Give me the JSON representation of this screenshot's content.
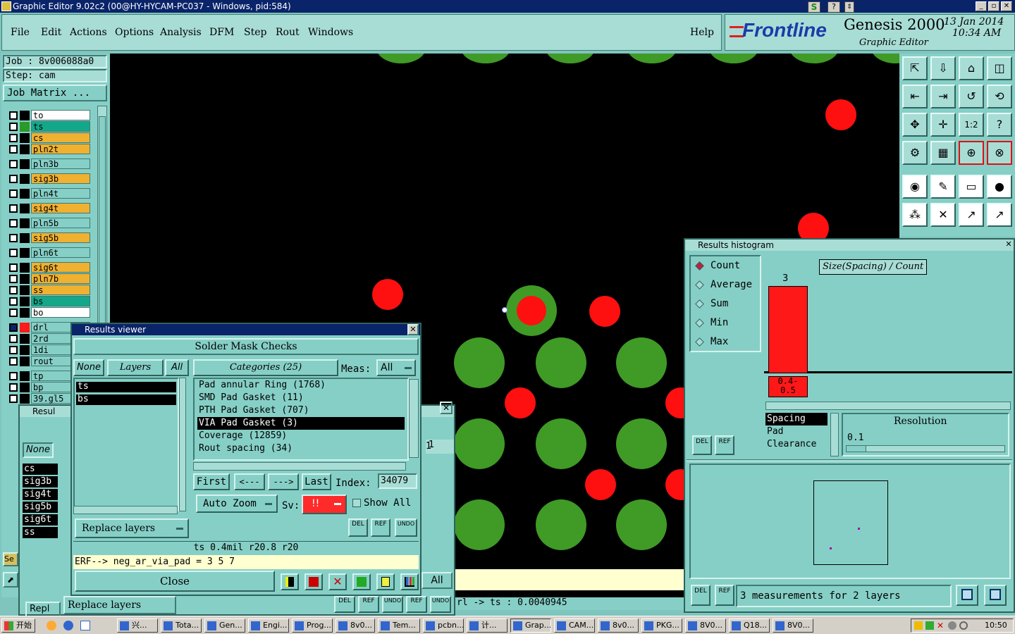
{
  "window": {
    "title": "Graphic Editor 9.02c2 (00@HY-HYCAM-PC037 - Windows, pid:584)"
  },
  "menu": {
    "items": [
      "File",
      "Edit",
      "Actions",
      "Options",
      "Analysis",
      "DFM",
      "Step",
      "Rout",
      "Windows"
    ],
    "help": "Help"
  },
  "brand": {
    "logo": "Frontline",
    "product": "Genesis 2000",
    "subtitle": "Graphic Editor",
    "date": "13 Jan 2014",
    "time": "10:34 AM"
  },
  "job": {
    "job": "Job : 8v006088a0",
    "step": "Step: cam",
    "matrix_button": "Job Matrix ..."
  },
  "layers": [
    {
      "name": "to",
      "color": "#ffffff"
    },
    {
      "name": "ts",
      "color": "#14a88a"
    },
    {
      "name": "cs",
      "color": "#f0b030"
    },
    {
      "name": "pln2t",
      "color": "#f0b030"
    },
    {
      "name": "pln3b",
      "color": "#86cfc6"
    },
    {
      "name": "sig3b",
      "color": "#f0b030"
    },
    {
      "name": "pln4t",
      "color": "#86cfc6"
    },
    {
      "name": "sig4t",
      "color": "#f0b030"
    },
    {
      "name": "pln5b",
      "color": "#86cfc6"
    },
    {
      "name": "sig5b",
      "color": "#f0b030"
    },
    {
      "name": "pln6t",
      "color": "#86cfc6"
    },
    {
      "name": "sig6t",
      "color": "#f0b030"
    },
    {
      "name": "pln7b",
      "color": "#f0b030"
    },
    {
      "name": "ss",
      "color": "#f0b030"
    },
    {
      "name": "bs",
      "color": "#14a88a"
    },
    {
      "name": "bo",
      "color": "#ffffff"
    },
    {
      "name": "drl",
      "color": "#86cfc6"
    },
    {
      "name": "2rd",
      "color": "#86cfc6"
    },
    {
      "name": "1di",
      "color": "#86cfc6"
    },
    {
      "name": "rout",
      "color": "#86cfc6"
    },
    {
      "name": "tp",
      "color": "#86cfc6"
    },
    {
      "name": "bp",
      "color": "#86cfc6"
    },
    {
      "name": "39.gl5",
      "color": "#86cfc6"
    }
  ],
  "results_viewer": {
    "title": "Results viewer",
    "header": "Solder Mask Checks",
    "none": "None",
    "layers": "Layers",
    "all": "All",
    "selected_layers": [
      "ts",
      "bs"
    ],
    "categories_label": "Categories (25)",
    "meas_label": "Meas:",
    "meas_value": "All",
    "categories": [
      "Pad annular Ring (1768)",
      "SMD Pad Gasket (11)",
      "PTH Pad Gasket (707)",
      "VIA Pad Gasket (3)",
      "Coverage (12859)",
      "Rout spacing (34)"
    ],
    "selected_category_index": 3,
    "first": "First",
    "prev": "<---",
    "next": "--->",
    "last": "Last",
    "index_label": "Index:",
    "index_value": "34079",
    "auto_zoom": "Auto Zoom",
    "sv_label": "Sv:",
    "sv_value": "!!",
    "show_all": "Show All",
    "replace_layers": "Replace layers",
    "status": "ts 0.4mil   r20.8   r20",
    "erf": "ERF--> neg_ar_via_pad = 3 5 7",
    "close": "Close",
    "del": "DEL",
    "ref": "REF",
    "undo": "UNDO"
  },
  "bg_dialog": {
    "title": "Resul",
    "none": "None",
    "layers": [
      "cs",
      "sig3b",
      "sig4t",
      "sig5b",
      "sig6t",
      "ss"
    ],
    "replace": "Replace layers",
    "repl": "Repl",
    "se": "Se",
    "all": "All",
    "one_a": "1",
    "one_b": "1",
    "status": "rl -> ts : 0.0040945"
  },
  "histogram": {
    "title": "Results histogram",
    "options": [
      "Count",
      "Average",
      "Sum",
      "Min",
      "Max"
    ],
    "selected": "Count",
    "chart_title": "Size(Spacing) / Count",
    "bar_value": "3",
    "bar_label": "0.4-\n0.5",
    "categories": [
      "Spacing",
      "Pad",
      "Clearance"
    ],
    "resolution_label": "Resolution",
    "resolution_value": "0.1",
    "summary": "3 measurements for 2 layers",
    "del": "DEL",
    "ref": "REF"
  },
  "taskbar": {
    "start": "开始",
    "tasks": [
      "兴...",
      "Tota...",
      "Gen...",
      "Engi...",
      "Prog...",
      "8v0...",
      "Tem...",
      "pcbn...",
      "计...",
      "Grap...",
      "CAM...",
      "8v0...",
      "PKG...",
      "8V0...",
      "Q18...",
      "8V0..."
    ],
    "clock": "10:50"
  },
  "icons": {
    "toolbar": [
      "zoom-home-icon",
      "zoom-fit-icon",
      "home-icon",
      "split-icon",
      "pan-left-icon",
      "pan-right-icon",
      "undo-view-icon",
      "snap-icon",
      "zoom-in-icon",
      "zoom-out-icon",
      "scale-1-2-icon",
      "query-icon",
      "settings-icon",
      "grid-icon",
      "measure-icon",
      "measure-pt-icon",
      "feature-icon",
      "edit-icon",
      "ruler-icon",
      "circle-icon",
      "net-icon",
      "cross-icon",
      "line-measure-icon",
      "point-measure-icon"
    ]
  }
}
